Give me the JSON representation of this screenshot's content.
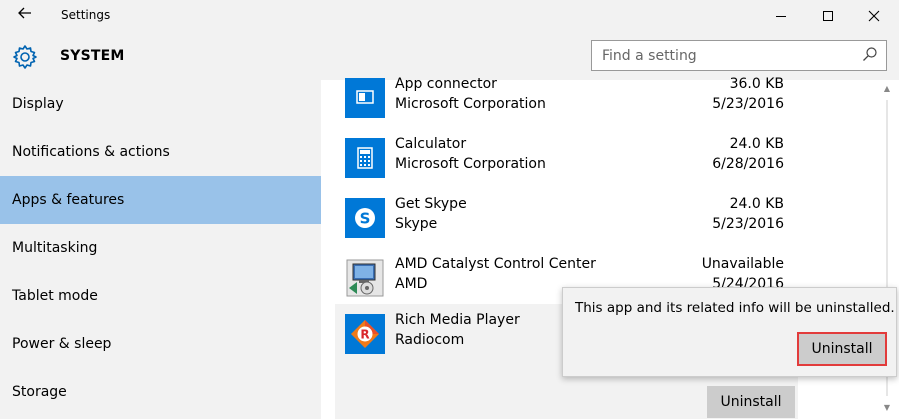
{
  "window": {
    "title": "Settings",
    "back_icon": "back-arrow-icon",
    "controls": [
      "minimize",
      "maximize",
      "close"
    ]
  },
  "header": {
    "icon": "gear-icon",
    "icon_color": "#0063b1",
    "section": "SYSTEM",
    "search_placeholder": "Find a setting",
    "search_value": ""
  },
  "sidebar": {
    "selected_bg": "#99c2e9",
    "items": [
      {
        "label": "Display"
      },
      {
        "label": "Notifications & actions"
      },
      {
        "label": "Apps & features",
        "selected": true
      },
      {
        "label": "Multitasking"
      },
      {
        "label": "Tablet mode"
      },
      {
        "label": "Power & sleep"
      },
      {
        "label": "Storage"
      }
    ]
  },
  "apps": [
    {
      "name": "App connector",
      "publisher": "Microsoft Corporation",
      "size": "36.0 KB",
      "date": "5/23/2016",
      "icon": "app-connector-icon"
    },
    {
      "name": "Calculator",
      "publisher": "Microsoft Corporation",
      "size": "24.0 KB",
      "date": "6/28/2016",
      "icon": "calculator-icon"
    },
    {
      "name": "Get Skype",
      "publisher": "Skype",
      "size": "24.0 KB",
      "date": "5/23/2016",
      "icon": "skype-icon"
    },
    {
      "name": "AMD Catalyst Control Center",
      "publisher": "AMD",
      "size": "Unavailable",
      "date": "5/24/2016",
      "icon": "amd-installer-icon"
    },
    {
      "name": "Rich Media Player",
      "publisher": "Radiocom",
      "size": "",
      "date": "",
      "icon": "rich-media-player-icon",
      "selected": true
    }
  ],
  "row_actions": {
    "uninstall_label": "Uninstall"
  },
  "flyout": {
    "message": "This app and its related info will be uninstalled.",
    "confirm_label": "Uninstall",
    "highlight_color": "#e23b3b"
  }
}
